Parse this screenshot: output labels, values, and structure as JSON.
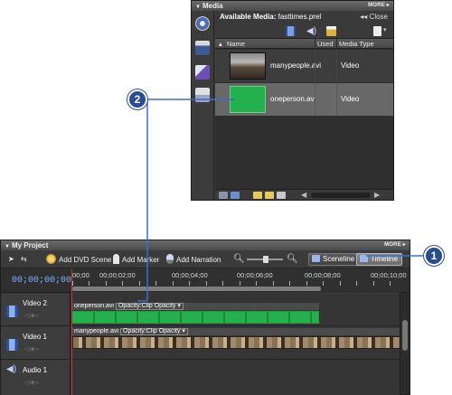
{
  "media_panel": {
    "title": "Media",
    "more": "MORE",
    "available_label": "Available Media:",
    "available_file": "fasttimes.prel",
    "close_label": "Close",
    "columns": {
      "name": "Name",
      "used": "Used",
      "media_type": "Media Type"
    },
    "items": [
      {
        "name": "manypeople.avi",
        "type": "Video"
      },
      {
        "name": "oneperson.avi",
        "type": "Video"
      }
    ]
  },
  "project_panel": {
    "title": "My Project",
    "more": "MORE",
    "toolbar": {
      "add_dvd_scene": "Add DVD Scene",
      "add_marker": "Add Marker",
      "add_narration": "Add Narration",
      "sceneline": "Sceneline",
      "timeline": "Timeline"
    },
    "timecode": "00;00;00;00",
    "ruler_labels": [
      "00;00",
      "00;00;02;00",
      "00;00;04;00",
      "00;00;06;00",
      "00;00;08;00",
      "00;00;10;00"
    ],
    "tracks": [
      {
        "name": "Video 2",
        "clip": "oneperson.avi",
        "opacity": "Opacity:Clip Opacity"
      },
      {
        "name": "Video 1",
        "clip": "manypeople.avi",
        "opacity": "Opacity:Clip Opacity"
      },
      {
        "name": "Audio 1"
      }
    ]
  },
  "callouts": {
    "one": "1",
    "two": "2"
  },
  "colors": {
    "panel_bg": "#3a3a3a",
    "selected_row": "#686868",
    "clip_green": "#22b14c",
    "callout_blue": "#2a4d8f",
    "playhead": "#d23333",
    "timecode": "#7fb5ff"
  },
  "icons": {
    "sidebar": [
      "media-film-icon",
      "clapper-icon",
      "effects-icon",
      "titles-icon"
    ],
    "toolbar": [
      "filmstrip-icon",
      "audio-icon",
      "still-image-icon",
      "new-item-icon"
    ]
  }
}
